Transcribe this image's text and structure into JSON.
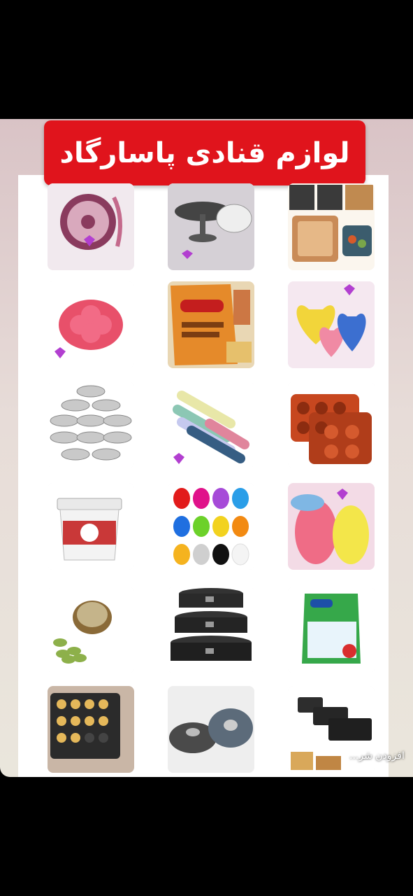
{
  "banner": {
    "title": "لوازم قنادی پاسارگاد"
  },
  "overlay": {
    "add_text": "افزودن شر..."
  },
  "colors": {
    "banner_bg": "#e0141c",
    "banner_text": "#ffffff",
    "story_bg": "#e2d3d2"
  },
  "products": [
    {
      "row": 1,
      "col": 1,
      "icon": "cake-pan-pink-icon"
    },
    {
      "row": 1,
      "col": 2,
      "icon": "cake-stand-icon"
    },
    {
      "row": 1,
      "col": 3,
      "icon": "square-baking-tray-icon"
    },
    {
      "row": 2,
      "col": 1,
      "icon": "silicone-heart-mold-icon"
    },
    {
      "row": 2,
      "col": 2,
      "icon": "vermicelli-pack-icon"
    },
    {
      "row": 2,
      "col": 3,
      "icon": "heart-silicone-molds-icon"
    },
    {
      "row": 3,
      "col": 1,
      "icon": "tealight-candles-icon"
    },
    {
      "row": 3,
      "col": 2,
      "icon": "fondant-rolls-icon"
    },
    {
      "row": 3,
      "col": 3,
      "icon": "muffin-silicone-mold-icon"
    },
    {
      "row": 4,
      "col": 1,
      "icon": "cream-tub-icon"
    },
    {
      "row": 4,
      "col": 2,
      "icon": "balloons-icon"
    },
    {
      "row": 4,
      "col": 3,
      "icon": "loaf-silicone-molds-icon"
    },
    {
      "row": 5,
      "col": 1,
      "icon": "cardamom-powder-icon"
    },
    {
      "row": 5,
      "col": 2,
      "icon": "springform-pans-icon"
    },
    {
      "row": 5,
      "col": 3,
      "icon": "powder-bag-icon"
    },
    {
      "row": 6,
      "col": 1,
      "icon": "mini-muffin-tray-icon"
    },
    {
      "row": 6,
      "col": 2,
      "icon": "bundt-pans-icon"
    },
    {
      "row": 6,
      "col": 3,
      "icon": "loaf-pans-icon"
    }
  ]
}
